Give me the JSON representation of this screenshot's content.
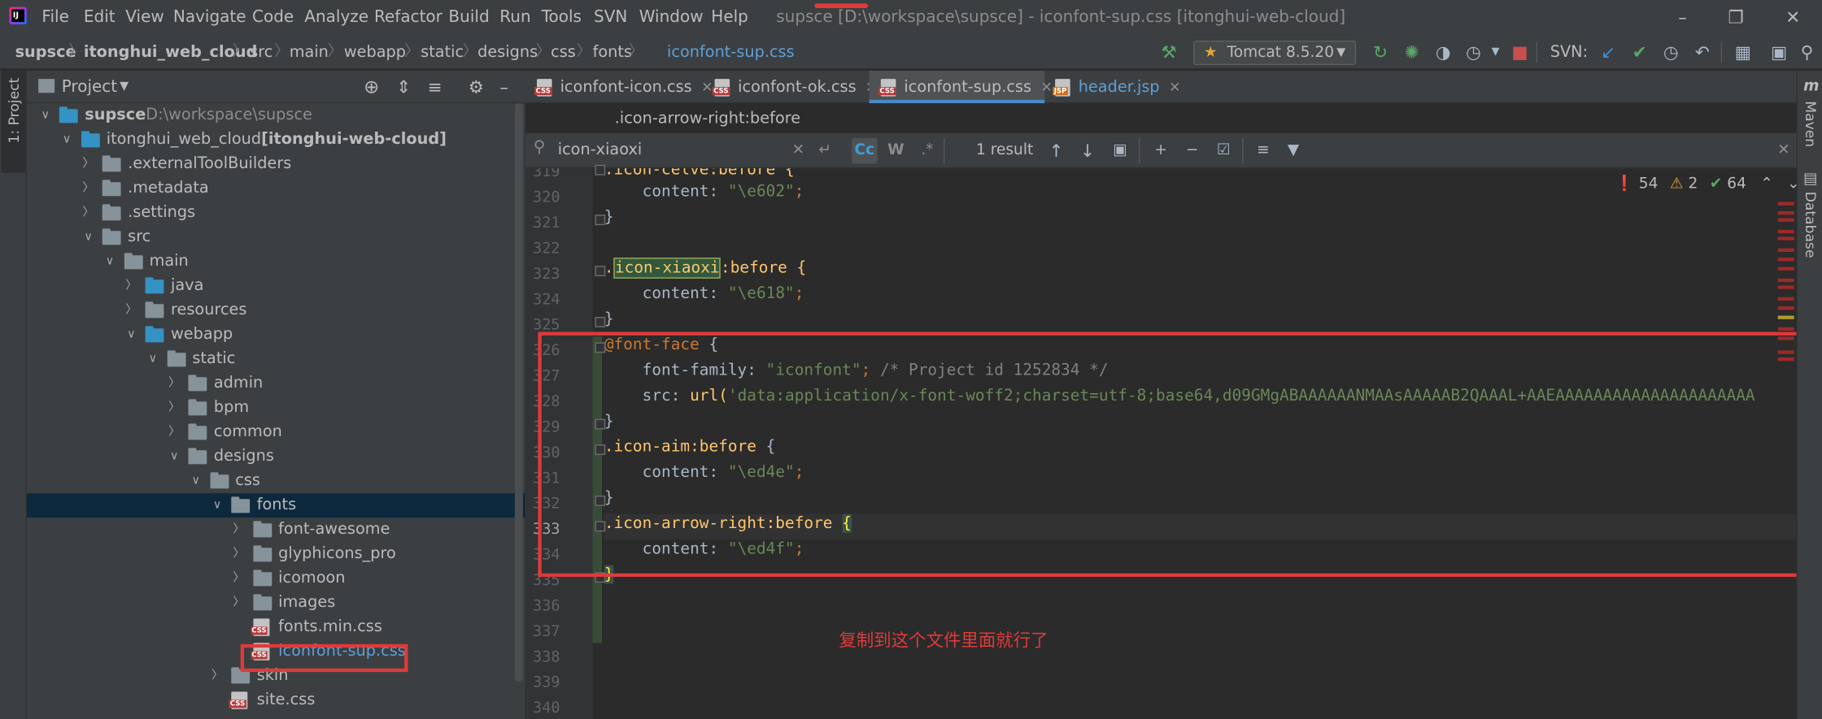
{
  "menubar": {
    "items": [
      "File",
      "Edit",
      "View",
      "Navigate",
      "Code",
      "Analyze",
      "Refactor",
      "Build",
      "Run",
      "Tools",
      "SVN",
      "Window",
      "Help"
    ],
    "title": "supsce [D:\\workspace\\supsce] - iconfont-sup.css [itonghui-web-cloud]"
  },
  "breadcrumb": [
    "supsce",
    "itonghui_web_cloud",
    "src",
    "main",
    "webapp",
    "static",
    "designs",
    "css",
    "fonts",
    "iconfont-sup.css"
  ],
  "toolbar": {
    "run_config": "Tomcat 8.5.20",
    "svn_label": "SVN:"
  },
  "left_strip": {
    "project_tab": "1: Project"
  },
  "right_strip": {
    "maven": "Maven",
    "database": "Database"
  },
  "project_panel": {
    "title": "Project",
    "tree": [
      {
        "label": "supsce",
        "extra": "D:\\workspace\\supsce",
        "depth": 0,
        "kind": "module",
        "open": true,
        "bold": true
      },
      {
        "label": "itonghui_web_cloud",
        "extra": "[itonghui-web-cloud]",
        "depth": 1,
        "kind": "module",
        "open": true
      },
      {
        "label": ".externalToolBuilders",
        "depth": 2,
        "kind": "folder",
        "open": false
      },
      {
        "label": ".metadata",
        "depth": 2,
        "kind": "folder",
        "open": false
      },
      {
        "label": ".settings",
        "depth": 2,
        "kind": "folder",
        "open": false
      },
      {
        "label": "src",
        "depth": 2,
        "kind": "folder",
        "open": true
      },
      {
        "label": "main",
        "depth": 3,
        "kind": "folder",
        "open": true
      },
      {
        "label": "java",
        "depth": 4,
        "kind": "folder-blue",
        "open": false
      },
      {
        "label": "resources",
        "depth": 4,
        "kind": "folder",
        "open": false
      },
      {
        "label": "webapp",
        "depth": 4,
        "kind": "folder-blue",
        "open": true
      },
      {
        "label": "static",
        "depth": 5,
        "kind": "folder",
        "open": true
      },
      {
        "label": "admin",
        "depth": 6,
        "kind": "folder",
        "open": false
      },
      {
        "label": "bpm",
        "depth": 6,
        "kind": "folder",
        "open": false
      },
      {
        "label": "common",
        "depth": 6,
        "kind": "folder",
        "open": false
      },
      {
        "label": "designs",
        "depth": 6,
        "kind": "folder",
        "open": true
      },
      {
        "label": "css",
        "depth": 7,
        "kind": "folder",
        "open": true
      },
      {
        "label": "fonts",
        "depth": 8,
        "kind": "folder",
        "open": true,
        "selected": true
      },
      {
        "label": "font-awesome",
        "depth": 9,
        "kind": "folder",
        "open": false
      },
      {
        "label": "glyphicons_pro",
        "depth": 9,
        "kind": "folder",
        "open": false
      },
      {
        "label": "icomoon",
        "depth": 9,
        "kind": "folder",
        "open": false
      },
      {
        "label": "images",
        "depth": 9,
        "kind": "folder",
        "open": false
      },
      {
        "label": "fonts.min.css",
        "depth": 9,
        "kind": "css"
      },
      {
        "label": "iconfont-sup.css",
        "depth": 9,
        "kind": "css",
        "link": true
      },
      {
        "label": "skin",
        "depth": 8,
        "kind": "folder",
        "open": false
      },
      {
        "label": "site.css",
        "depth": 8,
        "kind": "css"
      }
    ]
  },
  "editor": {
    "tabs": [
      {
        "label": "iconfont-icon.css",
        "type": "css"
      },
      {
        "label": "iconfont-ok.css",
        "type": "css"
      },
      {
        "label": "iconfont-sup.css",
        "type": "css",
        "active": true
      },
      {
        "label": "header.jsp",
        "type": "jsp"
      }
    ],
    "breadcrumb": ".icon-arrow-right:before",
    "find": {
      "query": "icon-xiaoxi",
      "result": "1 result",
      "cc": "Cc",
      "w": "W",
      "regex": ".*"
    },
    "inspections": {
      "errors": "54",
      "warnings": "2",
      "ok": "64"
    },
    "lines": [
      "319",
      "320",
      "321",
      "322",
      "323",
      "324",
      "325",
      "326",
      "327",
      "328",
      "329",
      "330",
      "331",
      "332",
      "333",
      "334",
      "335",
      "336",
      "337",
      "338",
      "339",
      "340"
    ],
    "current_line": "333",
    "code": {
      "l319": ".icon-celve:before {",
      "l320_prop": "content",
      "l320_val": "\"\\e602\"",
      "l323_sel": "icon-xiaoxi",
      "l323_rest": ":before {",
      "l324_val": "\"\\e618\"",
      "l326_at": "@font-face",
      "l327_prop": "font-family",
      "l327_val": "\"iconfont\"",
      "l327_comment": "/* Project id 1252834 */",
      "l328_prop": "src",
      "l328_fn": "url(",
      "l328_val": "'data:application/x-font-woff2;charset=utf-8;base64,d09GMgABAAAAAANMAAsAAAAAB2QAAAL+AAEAAAAAAAAAAAAAAAAAAAAA",
      "l330_sel": ".icon-aim:before",
      "l331_val": "\"\\ed4e\"",
      "l333_sel": ".icon-arrow-right:before",
      "l334_val": "\"\\ed4f\""
    }
  },
  "annotation": {
    "note": "复制到这个文件里面就行了"
  },
  "colors": {
    "accent": "#4a88c7",
    "annotation_red": "#e03a3a"
  }
}
